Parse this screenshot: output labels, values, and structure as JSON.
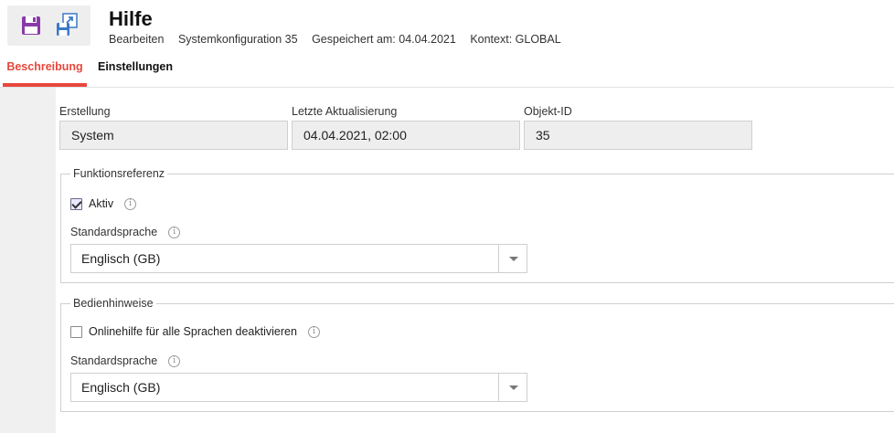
{
  "header": {
    "title": "Hilfe",
    "meta": [
      "Bearbeiten",
      "Systemkonfiguration 35",
      "Gespeichert am: 04.04.2021",
      "Kontext: GLOBAL"
    ],
    "save_icon": "save-icon",
    "save_as_icon": "save-as-icon"
  },
  "tabs": [
    {
      "label": "Beschreibung",
      "active": true
    },
    {
      "label": "Einstellungen",
      "active": false
    }
  ],
  "info": {
    "erstellung": {
      "label": "Erstellung",
      "value": "System"
    },
    "aktualisierung": {
      "label": "Letzte Aktualisierung",
      "value": "04.04.2021, 02:00"
    },
    "objekt_id": {
      "label": "Objekt-ID",
      "value": "35"
    }
  },
  "funktionsreferenz": {
    "legend": "Funktionsreferenz",
    "aktiv_label": "Aktiv",
    "aktiv_checked": true,
    "sprache_label": "Standardsprache",
    "sprache_value": "Englisch (GB)"
  },
  "bedienhinweise": {
    "legend": "Bedienhinweise",
    "onlinehilfe_label": "Onlinehilfe für alle Sprachen deaktivieren",
    "onlinehilfe_checked": false,
    "sprache_label": "Standardsprache",
    "sprache_value": "Englisch (GB)"
  },
  "colors": {
    "accent": "#e8473c",
    "icon_purple": "#8a3aa8",
    "icon_blue": "#3a78c8"
  }
}
